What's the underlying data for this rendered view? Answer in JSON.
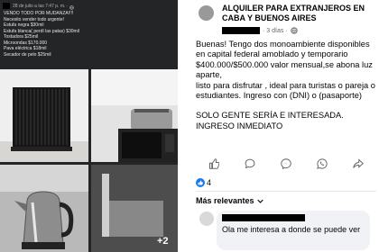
{
  "left_post": {
    "meta": "28 de julio a las 7:47 p. m. ·",
    "lines": [
      "VENDO TODO POR MUDANZA!!!!",
      "Necesito vender todo urgente!",
      "Estufa negra $30mil",
      "Estufa blanca( perdí las patas) $30mil",
      "Tostadora $25mil",
      "Microondas $170.000",
      "Pava eléctrica $18mil",
      "Secador de pelo $25mil"
    ],
    "more_photos": "+2"
  },
  "right_post": {
    "group_title": "ALQUILER PARA EXTRANJEROS EN CABA Y BUENOS AIRES",
    "time": "· 3 días ·",
    "paragraphs": [
      "Buenas! Tengo dos monoambiente disponibles en capital federal amoblado y temporario $400.000/$500.000 valor mensual,se abona luz aparte,\nlisto para disfrutar , ideal para turistas o pareja o estudiantes. Ingreso con (DNI) o (pasaporte)",
      "SOLO GENTE SERÍA E INTERESADA.\nINGRESO INMEDIATO"
    ],
    "reaction_count": "4",
    "sort_label": "Más relevantes",
    "comment_text": "Ola me interesa a donde se puede ver"
  },
  "colors": {
    "left_bg": "#242526",
    "fb_blue": "#1877f2",
    "comment_bg": "#f0f2f5"
  },
  "icons": [
    "globe-icon",
    "like-icon",
    "comment-icon",
    "messenger-icon",
    "whatsapp-icon",
    "share-icon",
    "like-reaction-icon",
    "chevron-down-icon"
  ]
}
